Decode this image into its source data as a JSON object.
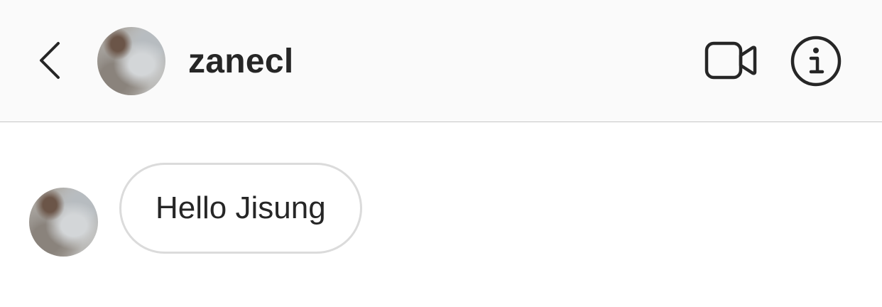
{
  "header": {
    "username": "zanecl",
    "back_icon": "chevron-left-icon",
    "video_icon": "video-camera-icon",
    "info_icon": "info-icon"
  },
  "conversation": {
    "messages": [
      {
        "text": "Hello Jisung",
        "direction": "incoming"
      }
    ]
  },
  "colors": {
    "header_bg": "#fafafa",
    "text": "#262626",
    "bubble_border": "#dbdbdb",
    "divider": "#c7c7c7"
  }
}
